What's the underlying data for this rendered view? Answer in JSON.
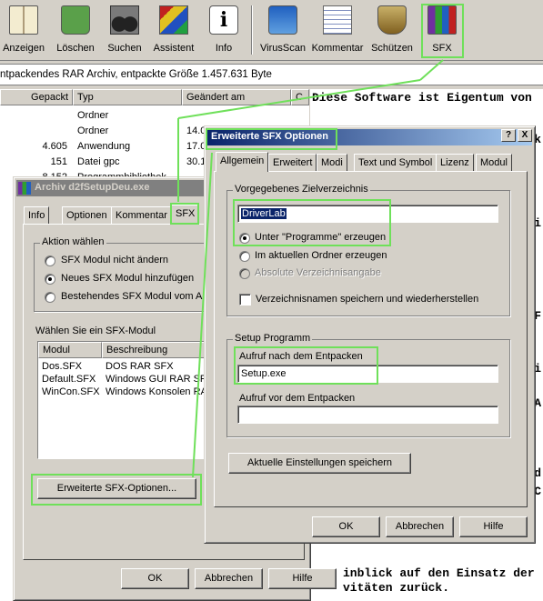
{
  "toolbar": {
    "buttons": [
      {
        "label": "Anzeigen",
        "icon": "book-icon"
      },
      {
        "label": "Löschen",
        "icon": "recycle-bin-icon"
      },
      {
        "label": "Suchen",
        "icon": "binoculars-icon"
      },
      {
        "label": "Assistent",
        "icon": "wizard-icon"
      },
      {
        "label": "Info",
        "icon": "info-icon"
      },
      {
        "label": "VirusScan",
        "icon": "virusscan-icon"
      },
      {
        "label": "Kommentar",
        "icon": "comment-icon"
      },
      {
        "label": "Schützen",
        "icon": "shield-icon"
      },
      {
        "label": "SFX",
        "icon": "sfx-archive-icon"
      }
    ]
  },
  "statusbar": {
    "text": "ntpackendes RAR Archiv, entpackte Größe 1.457.631 Byte"
  },
  "filelist": {
    "columns": [
      "Gepackt",
      "Typ",
      "Geändert am",
      "C"
    ],
    "rows": [
      {
        "packed": "",
        "type": "Ordner",
        "date": ""
      },
      {
        "packed": "",
        "type": "Ordner",
        "date": "14.0"
      },
      {
        "packed": "4.605",
        "type": "Anwendung",
        "date": "17.0"
      },
      {
        "packed": "151",
        "type": "Datei gpc",
        "date": "30.1"
      },
      {
        "packed": "8.152",
        "type": "Programmbibliothek",
        "date": ""
      }
    ]
  },
  "textview": {
    "top_line": "Diese Software ist Eigentum von",
    "bottom_lines": [
      "inblick auf den Einsatz der",
      "vitäten zurück."
    ],
    "right_fragments": [
      "k",
      "i",
      "F",
      "i",
      "A",
      "d",
      "C"
    ]
  },
  "archive_dialog": {
    "title": "Archiv d2fSetupDeu.exe",
    "tabs": [
      "Info",
      "Optionen",
      "Kommentar",
      "SFX"
    ],
    "action_group": "Aktion wählen",
    "actions": [
      "SFX Modul nicht ändern",
      "Neues SFX Modul hinzufügen",
      "Bestehendes SFX Modul vom Arc"
    ],
    "module_label": "Wählen Sie ein SFX-Modul",
    "module_columns": [
      "Modul",
      "Beschreibung"
    ],
    "modules": [
      {
        "name": "Dos.SFX",
        "desc": "DOS RAR SFX"
      },
      {
        "name": "Default.SFX",
        "desc": "Windows GUI RAR SF"
      },
      {
        "name": "WinCon.SFX",
        "desc": "Windows Konsolen RA"
      }
    ],
    "advanced_button": "Erweiterte SFX-Optionen...",
    "ok": "OK",
    "cancel": "Abbrechen",
    "help": "Hilfe"
  },
  "sfx_dialog": {
    "title": "Erweiterte SFX Optionen",
    "title_help": "?",
    "title_close": "X",
    "tabs": [
      "Allgemein",
      "Erweitert",
      "Modi",
      "Text und Symbol",
      "Lizenz",
      "Modul"
    ],
    "dest_group": "Vorgegebenes Zielverzeichnis",
    "dest_value": "DriverLab",
    "dest_options": [
      "Unter \"Programme\" erzeugen",
      "Im aktuellen Ordner erzeugen",
      "Absolute Verzeichnisangabe"
    ],
    "save_names": "Verzeichnisnamen speichern und wiederherstellen",
    "setup_group": "Setup Programm",
    "run_after_label": "Aufruf nach dem Entpacken",
    "run_after_value": "Setup.exe",
    "run_before_label": "Aufruf vor dem Entpacken",
    "run_before_value": "",
    "save_settings": "Aktuelle Einstellungen speichern",
    "ok": "OK",
    "cancel": "Abbrechen",
    "help": "Hilfe"
  },
  "colors": {
    "title_active": "#0a246a",
    "title_inactive": "#808080",
    "highlight": "#6fe05a"
  }
}
